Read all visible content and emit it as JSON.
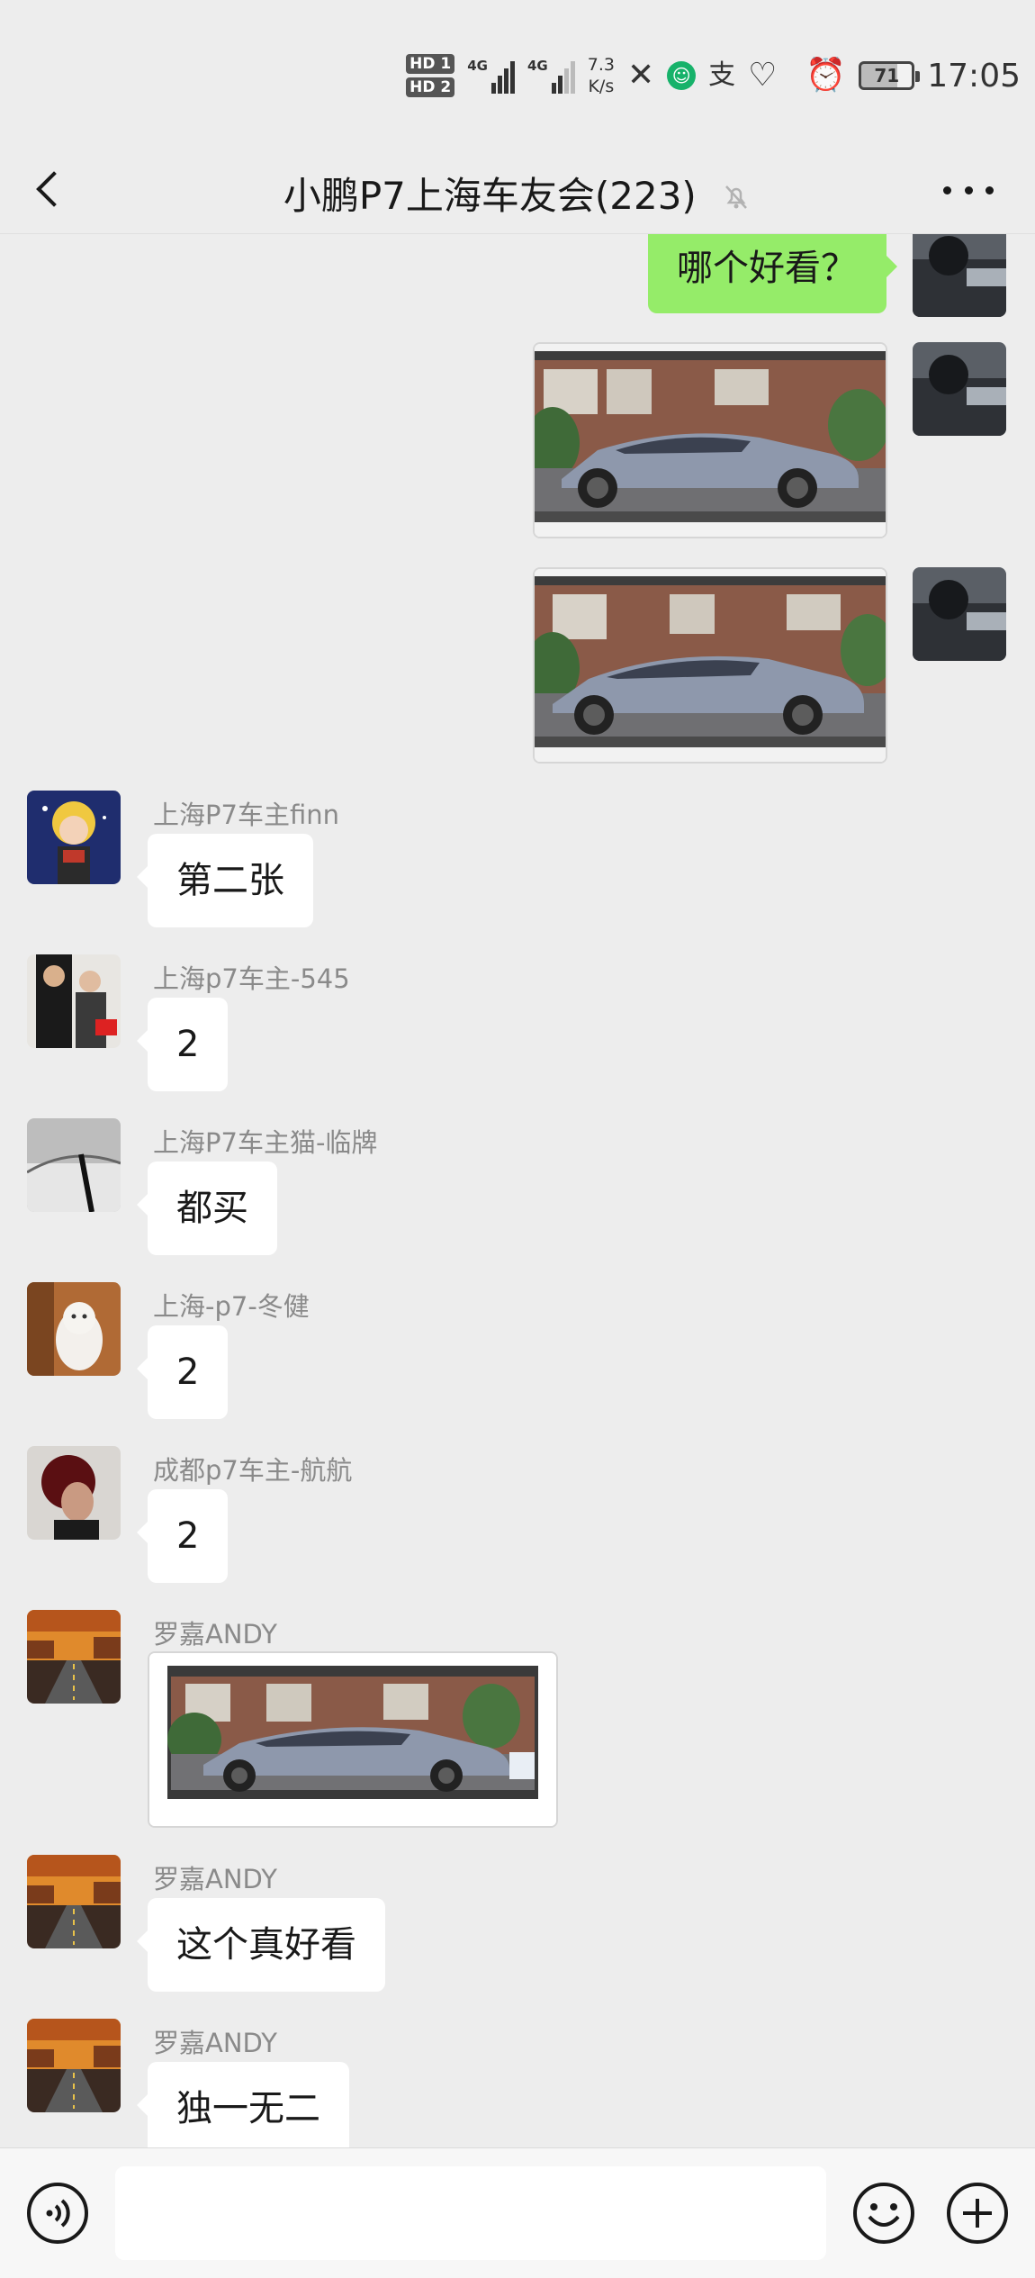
{
  "status_bar": {
    "hd1": "HD 1",
    "hd2": "HD 2",
    "net1": "4G",
    "net2": "4G",
    "speed_value": "7.3",
    "speed_unit": "K/s",
    "battery": "71",
    "time": "17:05",
    "icons": [
      "hd-icon",
      "signal-icon",
      "wechat-icon",
      "green-app-icon",
      "alipay-icon",
      "heart-icon",
      "alarm-icon",
      "battery-icon"
    ]
  },
  "nav": {
    "title": "小鹏P7上海车友会(223)"
  },
  "messages": {
    "m1_text": "哪个好看？",
    "finn_name": "上海P7车主finn",
    "finn_text": "第二张",
    "u545_name": "上海p7车主-545",
    "u545_text": "2",
    "cat_name": "上海P7车主猫-临牌",
    "cat_text": "都买",
    "dongjian_name": "上海-p7-冬健",
    "dongjian_text": "2",
    "hanghang_name": "成都p7车主-航航",
    "hanghang_text": "2",
    "andy_name_1": "罗嘉ANDY",
    "andy_name_2": "罗嘉ANDY",
    "andy_text_2": "这个真好看",
    "andy_name_3": "罗嘉ANDY",
    "andy_text_3": "独一无二"
  },
  "colors": {
    "background": "#ededed",
    "my_bubble": "#95ec69",
    "their_bubble": "#ffffff",
    "car": "#8e98ac"
  }
}
